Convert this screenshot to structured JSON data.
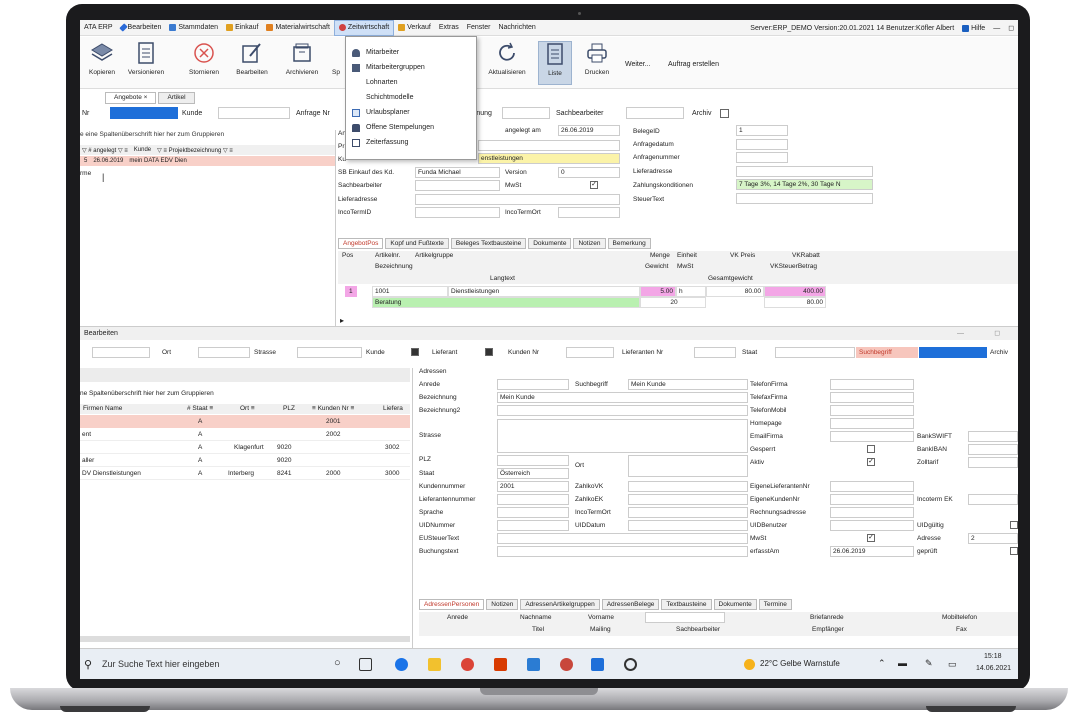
{
  "menubar": {
    "items": [
      {
        "label": "ATA ERP",
        "color": "#2a6ad8"
      },
      {
        "label": "Bearbeiten",
        "color": "#2a6ad8"
      },
      {
        "label": "Stammdaten",
        "color": "#3a7ad0"
      },
      {
        "label": "Einkauf",
        "color": "#e0a020"
      },
      {
        "label": "Materialwirtschaft",
        "color": "#e08020"
      },
      {
        "label": "Zeitwirtschaft",
        "color": "#d04040"
      },
      {
        "label": "Verkauf",
        "color": "#e0a020"
      },
      {
        "label": "Extras",
        "color": ""
      },
      {
        "label": "Fenster",
        "color": ""
      },
      {
        "label": "Nachrichten",
        "color": ""
      }
    ],
    "server_info": "Server:ERP_DEMO Version:20.01.2021 14 Benutzer:Köfler Albert",
    "help": "Hilfe",
    "minimize": "—",
    "restore": "◻"
  },
  "toolbar": {
    "buttons": [
      "Kopieren",
      "Versionieren",
      "Stornieren",
      "Bearbeiten",
      "Archivieren",
      "Sp",
      "Aktualisieren",
      "Liste",
      "Drucken"
    ],
    "weiter": "Weiter...",
    "auftrag": "Auftrag erstellen"
  },
  "dropdown": {
    "items": [
      {
        "label": "Mitarbeiter",
        "icon": "people-icon"
      },
      {
        "label": "Mitarbeitergruppen",
        "icon": "group-icon"
      },
      {
        "label": "Lohnarten",
        "icon": ""
      },
      {
        "label": "Schichtmodelle",
        "icon": ""
      },
      {
        "label": "Urlaubsplaner",
        "icon": "calendar-icon"
      },
      {
        "label": "Offene Stempelungen",
        "icon": "stamp-icon"
      },
      {
        "label": "Zeiterfassung",
        "icon": "clock-icon"
      }
    ]
  },
  "upper": {
    "tabs": [
      "Angebote",
      "Artikel"
    ],
    "tab_close": "×",
    "filter": {
      "nr": "Nr",
      "kunde": "Kunde",
      "anfrage": "Anfrage Nr",
      "zeichnung": "zeichnung",
      "sachbearbeiter": "Sachbearbeiter",
      "archiv": "Archiv"
    },
    "group_hint": "e eine Spaltenüberschrift hier her zum Gruppieren",
    "grid_header": [
      "▽ # angelegt ▽ ≡",
      "Kunde",
      "▽ ≡ Projektbezeichnung ▽ ≡"
    ],
    "grid_row": [
      "5",
      "26.06.2019",
      "mein DATA EDV Dien"
    ],
    "row_label": "rme",
    "form": {
      "an": "Ang",
      "pr": "Pr",
      "ku": "Ku",
      "angelegt_label": "angelegt am",
      "angelegt_value": "26.06.2019",
      "dienstleistungen": "enstleistungen",
      "sb_label": "SB Einkauf des Kd.",
      "sb_value": "Funda Michael",
      "version_label": "Version",
      "version_value": "0",
      "sachbearbeiter": "Sachbearbeiter",
      "mwst": "MwSt",
      "lieferadresse": "Lieferadresse",
      "incoterm_id": "IncoTermID",
      "incoterm_ort": "IncoTermOrt",
      "right_labels": [
        "BelegeID",
        "Anfragedatum",
        "Anfragenummer",
        "Lieferadresse",
        "Zahlungskonditionen",
        "SteuerText"
      ],
      "beleg_id": "1",
      "zahlung": "7 Tage 3%, 14 Tage 2%, 30 Tage N"
    },
    "subtabs": [
      "AngebotPos",
      "Kopf und Fußtexte",
      "Beleges Textbausteine",
      "Dokumente",
      "Notizen",
      "Bemerkung"
    ],
    "pos_header1": [
      "Pos",
      "Artikelnr.",
      "Artikelgruppe",
      "Menge",
      "Einheit",
      "VK Preis",
      "VKRabatt"
    ],
    "pos_header2": [
      "Bezeichnung",
      "Gewicht",
      "MwSt",
      "VKSteuerBetrag"
    ],
    "pos_header3": [
      "Langtext",
      "Gesamtgewicht"
    ],
    "pos_row": {
      "num": "1",
      "artikel": "1001",
      "gruppe": "Dienstleistungen",
      "menge": "5.00",
      "einheit": "h",
      "preis": "80.00",
      "rabatt": "400.00",
      "bez": "Beratung",
      "mwst": "20",
      "steuer": "80.00"
    }
  },
  "lower": {
    "title": "Bearbeiten",
    "filter": {
      "ort": "Ort",
      "strasse": "Strasse",
      "kunde": "Kunde",
      "lieferant": "Lieferant",
      "kunden_nr": "Kunden Nr",
      "lieferanten_nr": "Lieferanten Nr",
      "staat": "Staat",
      "suchbegriff": "Suchbegriff",
      "archiv": "Archiv"
    },
    "group_hint": "ne Spaltenüberschrift hier her zum Gruppieren",
    "grid_header": [
      "Firmen Name",
      "# Staat ≡",
      "Ort ≡",
      "PLZ",
      "≡ Kunden Nr ≡",
      "Liefera"
    ],
    "rows": [
      {
        "name": "",
        "staat": "A",
        "ort": "",
        "plz": "",
        "kunden": "2001",
        "liefer": ""
      },
      {
        "name": "ent",
        "staat": "A",
        "ort": "",
        "plz": "",
        "kunden": "2002",
        "liefer": ""
      },
      {
        "name": "",
        "staat": "A",
        "ort": "Klagenfurt",
        "plz": "9020",
        "kunden": "",
        "liefer": "3002"
      },
      {
        "name": "aller",
        "staat": "A",
        "ort": "",
        "plz": "9020",
        "kunden": "",
        "liefer": ""
      },
      {
        "name": "DV Dienstleistungen",
        "staat": "A",
        "ort": "Interberg",
        "plz": "8241",
        "kunden": "2000",
        "liefer": "3000"
      }
    ],
    "address": {
      "section": "Adressen",
      "left_labels": [
        "Anrede",
        "Bezeichnung",
        "Bezeichnung2",
        "Strasse",
        "PLZ",
        "Staat",
        "Kundennummer",
        "Lieferantennummer",
        "Sprache",
        "UIDNummer",
        "EUSteuerText",
        "Buchungstext"
      ],
      "suchbegriff_label": "Suchbegriff",
      "suchbegriff_value": "Mein Kunde",
      "bezeichnung_value": "Mein Kunde",
      "ort_label": "Ort",
      "staat_value": "Österreich",
      "kundennummer_value": "2001",
      "mid_labels": [
        "ZahlkoVK",
        "ZahlkoEK",
        "IncoTermOrt",
        "UIDDatum"
      ],
      "right_labels": [
        "TelefonFirma",
        "TelefaxFirma",
        "TelefonMobil",
        "Homepage",
        "EmailFirma",
        "Gesperrt",
        "Aktiv",
        "EigeneLieferantenNr",
        "EigeneKundenNr",
        "Rechnungsadresse",
        "UIDBenutzer",
        "MwSt",
        "erfasstAm"
      ],
      "erfasst_value": "26.06.2019",
      "far_labels": [
        "BankSWIFT",
        "BankIBAN",
        "Zolltarif",
        "Incoterm EK",
        "UIDgültig",
        "Adresse",
        "geprüft"
      ],
      "adresse_value": "2"
    },
    "subtabs": [
      "AdressenPersonen",
      "Notizen",
      "AdressenArtikelgruppen",
      "AdressenBelege",
      "Textbausteine",
      "Dokumente",
      "Termine"
    ],
    "person_header1": [
      "Anrede",
      "Nachname",
      "Vorname",
      "Briefanrede",
      "Mobiltelefon"
    ],
    "person_header2": [
      "Titel",
      "Mailing",
      "Sachbearbeiter",
      "Empfänger",
      "Fax"
    ]
  },
  "taskbar": {
    "search_placeholder": "Zur Suche Text hier eingeben",
    "weather": "22°C Gelbe Warnstufe",
    "time": "15:18",
    "date": "14.06.2021"
  }
}
